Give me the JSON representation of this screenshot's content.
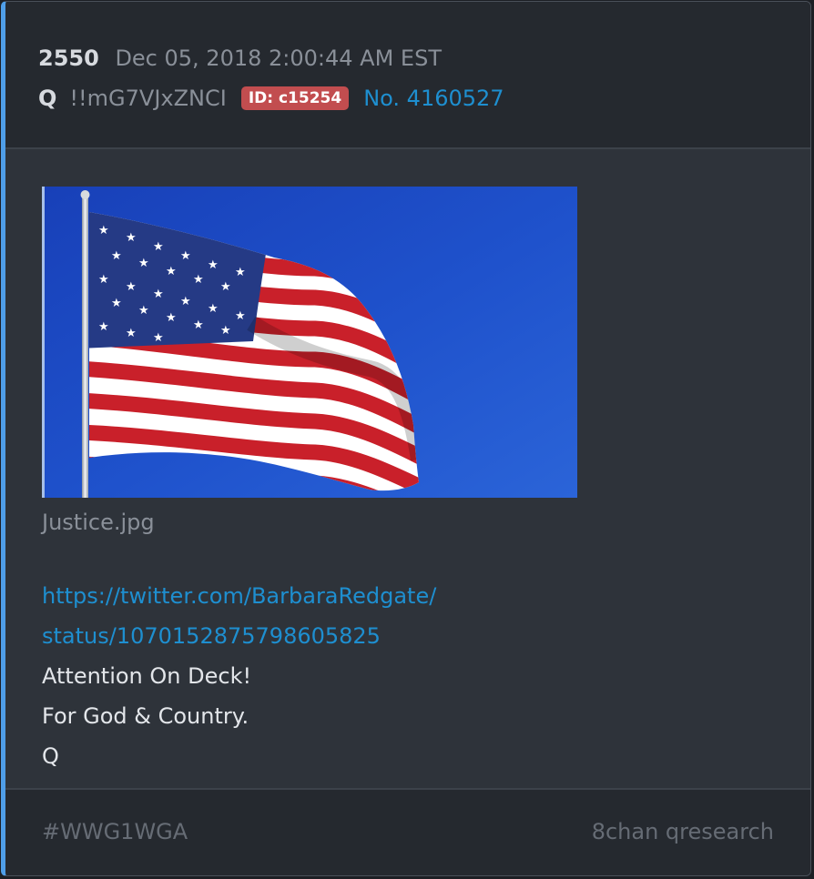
{
  "post": {
    "number": "2550",
    "date": "Dec 05, 2018 2:00:44 AM EST",
    "author": "Q",
    "tripcode": "!!mG7VJxZNCI",
    "id_badge": "ID: c15254",
    "post_no": "No. 4160527"
  },
  "attachment": {
    "filename": "Justice.jpg"
  },
  "body": {
    "link_line1": "https://twitter.com/BarbaraRedgate/",
    "link_line2": "status/1070152875798605825",
    "line1": "Attention On Deck!",
    "line2": "For God & Country.",
    "line3": "Q"
  },
  "footer": {
    "tag": "#WWG1WGA",
    "source": "8chan qresearch"
  },
  "colors": {
    "accent": "#4f9ee8",
    "link": "#1e8fd0",
    "id_badge": "#c24d4f",
    "card_bg": "#2e333a",
    "header_bg": "#25292f"
  },
  "icons": {
    "flag_image": "american-flag-image"
  }
}
